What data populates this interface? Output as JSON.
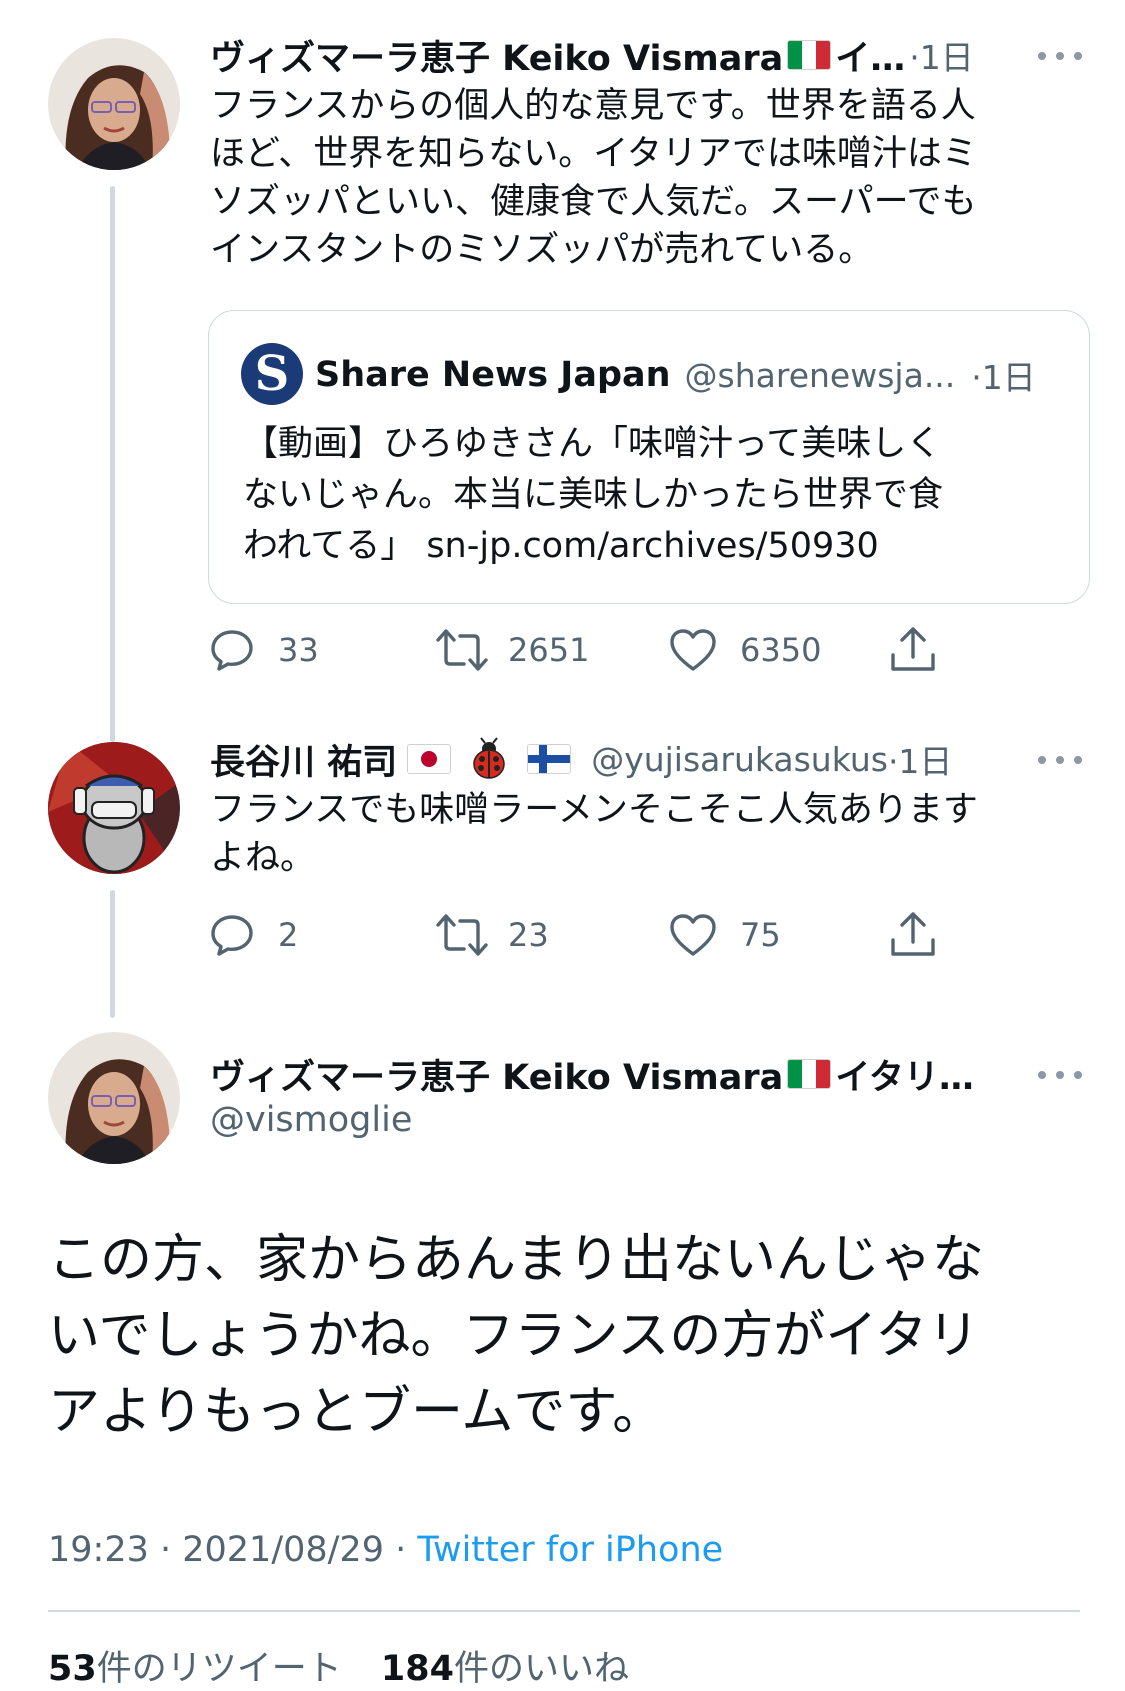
{
  "tweet1": {
    "name": "ヴィズマーラ恵子 Keiko Vismara",
    "name_suffix": "イ…",
    "time": "·1日",
    "text": "フランスからの個人的な意見です。世界を語る人\nほど、世界を知らない。イタリアでは味噌汁はミ\nソズッパといい、健康食で人気だ。スーパーでも\nインスタントのミソズッパが売れている。",
    "quote": {
      "logo_letter": "S",
      "name": "Share News Japan",
      "handle": "@sharenewsja...",
      "time": "·1日",
      "text": "【動画】ひろゆきさん「味噌汁って美味しく\nないじゃん。本当に美味しかったら世界で食\nわれてる」 sn-jp.com/archives/50930"
    },
    "replies": "33",
    "retweets": "2651",
    "likes": "6350"
  },
  "tweet2": {
    "name": "長谷川 祐司",
    "handle": "@yujisarukasukus",
    "time": "·1日",
    "text": "フランスでも味噌ラーメンそこそこ人気あります\nよね。",
    "replies": "2",
    "retweets": "23",
    "likes": "75"
  },
  "main": {
    "name": "ヴィズマーラ恵子 Keiko Vismara",
    "name_suffix": "イタリ…",
    "handle": "@vismoglie",
    "text": "この方、家からあんまり出ないんじゃな\nいでしょうかね。フランスの方がイタリ\nアよりもっとブームです。",
    "time": "19:23 · 2021/08/29 · ",
    "app": "Twitter for iPhone",
    "retweet_count": "53",
    "retweet_label": "件のリツイート",
    "like_count": "184",
    "like_label": "件のいいね"
  },
  "icons": {
    "reply": "speech-bubble-icon",
    "retweet": "retweet-arrows-icon",
    "like": "heart-icon",
    "share": "share-upload-icon",
    "more": "more-dots-icon",
    "ladybug": "ladybug-emoji"
  },
  "colors": {
    "text": "#0f1419",
    "secondary": "#536471",
    "link": "#1d9bf0",
    "border": "#cfd9de"
  }
}
